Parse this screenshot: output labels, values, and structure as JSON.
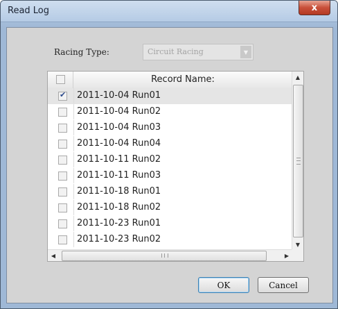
{
  "window": {
    "title": "Read Log",
    "close_glyph": "x"
  },
  "racing": {
    "label": "Racing Type:",
    "value": "Circuit Racing",
    "arrow_icon": "chevron-down-icon"
  },
  "list": {
    "header": "Record Name:",
    "rows": [
      {
        "name": "2011-10-04 Run01",
        "checked": true
      },
      {
        "name": "2011-10-04 Run02",
        "checked": false
      },
      {
        "name": "2011-10-04 Run03",
        "checked": false
      },
      {
        "name": "2011-10-04 Run04",
        "checked": false
      },
      {
        "name": "2011-10-11 Run02",
        "checked": false
      },
      {
        "name": "2011-10-11 Run03",
        "checked": false
      },
      {
        "name": "2011-10-18 Run01",
        "checked": false
      },
      {
        "name": "2011-10-18 Run02",
        "checked": false
      },
      {
        "name": "2011-10-23 Run01",
        "checked": false
      },
      {
        "name": "2011-10-23 Run02",
        "checked": false
      }
    ]
  },
  "buttons": {
    "ok": "OK",
    "cancel": "Cancel"
  },
  "colors": {
    "title_bar": "#b5cbe5",
    "close_button": "#c8503a",
    "client_bg": "#d4d4d4"
  }
}
